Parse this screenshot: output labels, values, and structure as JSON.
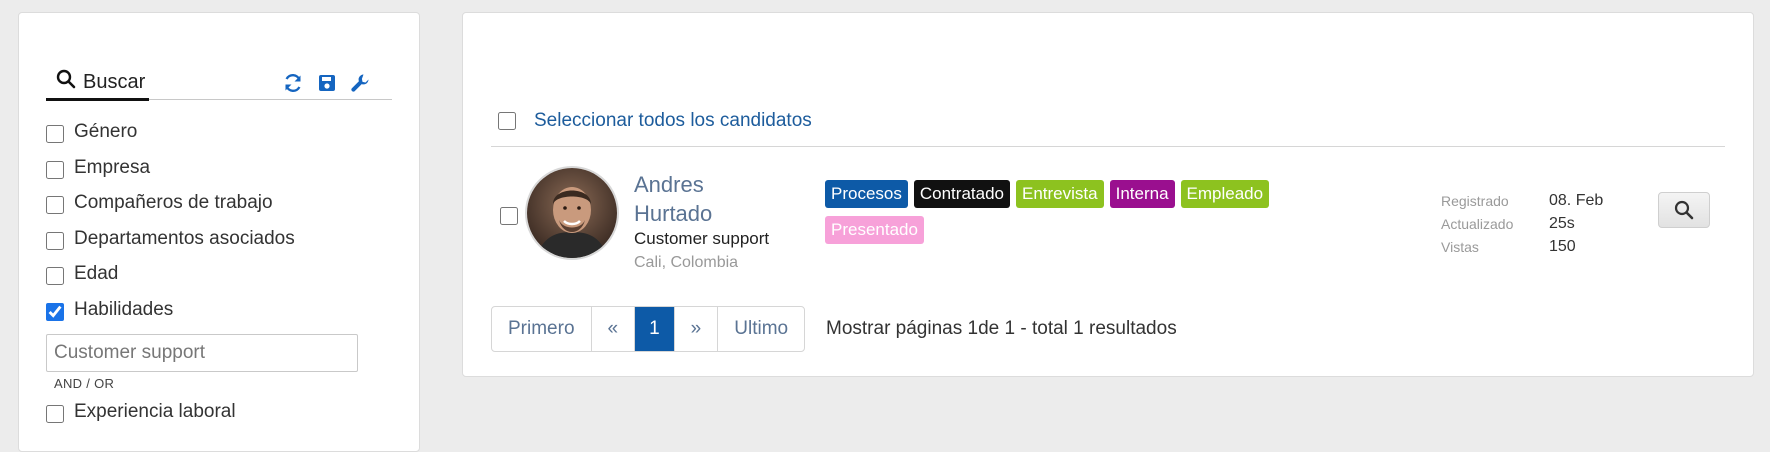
{
  "sidebar": {
    "search_label": "Buscar",
    "icons": [
      "refresh-icon",
      "save-icon",
      "wrench-icon"
    ],
    "filters": [
      {
        "label": "Género",
        "checked": false
      },
      {
        "label": "Empresa",
        "checked": false
      },
      {
        "label": "Compañeros de trabajo",
        "checked": false
      },
      {
        "label": "Departamentos asociados",
        "checked": false
      },
      {
        "label": "Edad",
        "checked": false
      },
      {
        "label": "Habilidades",
        "checked": true
      }
    ],
    "skills_input_placeholder": "Customer support",
    "and_or": "AND / OR",
    "after_filters": [
      {
        "label": "Experiencia laboral",
        "checked": false
      }
    ]
  },
  "main": {
    "select_all_label": "Seleccionar todos los candidatos",
    "candidate": {
      "name": "Andres Hurtado",
      "role": "Customer support",
      "location": "Cali, Colombia",
      "tags": [
        {
          "label": "Procesos",
          "color": "#0d5aa7"
        },
        {
          "label": "Contratado",
          "color": "#111111"
        },
        {
          "label": "Entrevista",
          "color": "#8dc21f"
        },
        {
          "label": "Interna",
          "color": "#9a0f8f"
        },
        {
          "label": "Empleado",
          "color": "#8dc21f"
        },
        {
          "label": "Presentado",
          "color": "#f7a1d9"
        }
      ],
      "meta": [
        {
          "key": "Registrado",
          "value": "08. Feb"
        },
        {
          "key": "Actualizado",
          "value": "25s"
        },
        {
          "key": "Vistas",
          "value": "150"
        }
      ]
    },
    "pagination": {
      "first": "Primero",
      "prev": "«",
      "current": "1",
      "next": "»",
      "last": "Ultimo",
      "summary_prefix": "Mostrar páginas ",
      "page_from": "1",
      "of_text": "de ",
      "page_to": "1",
      "total_text": " - total ",
      "total": "1",
      "results_text": " resultados"
    }
  },
  "colors": {
    "accent": "#0d5aa7",
    "link": "#1d5c9c"
  }
}
